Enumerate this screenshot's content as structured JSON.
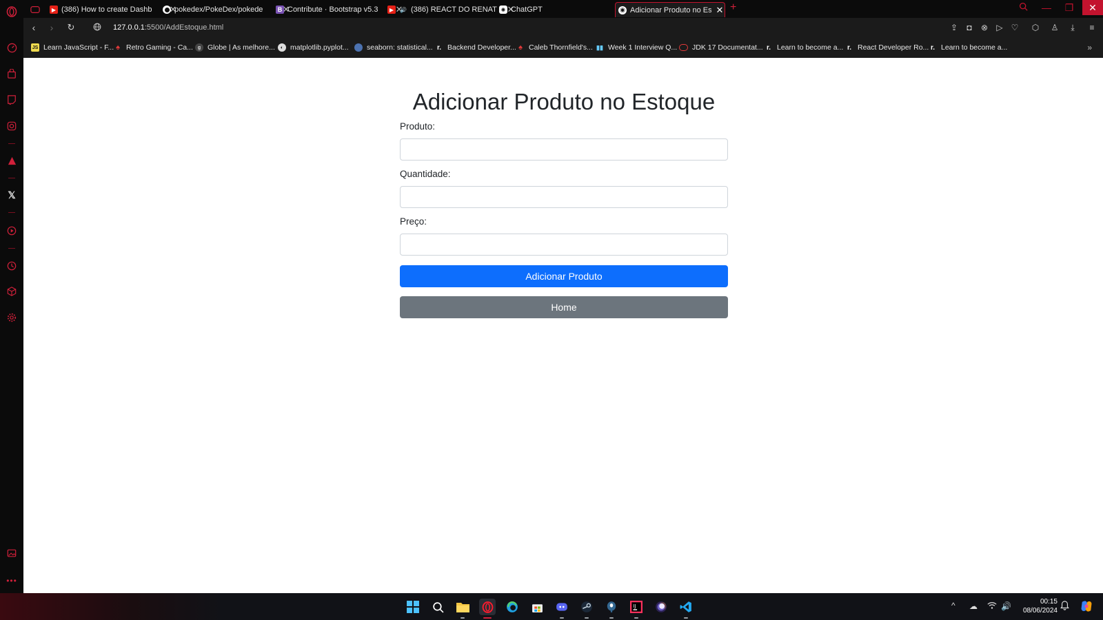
{
  "browser": {
    "tabs": [
      {
        "title": "(386) How to create Dashb",
        "icon": "youtube-icon"
      },
      {
        "title": "pokedex/PokeDex/pokede",
        "icon": "github-icon"
      },
      {
        "title": "Contribute · Bootstrap v5.3",
        "icon": "bootstrap-icon"
      },
      {
        "title": "(386) REACT DO RENAT",
        "icon": "youtube-icon"
      },
      {
        "title": "ChatGPT",
        "icon": "chatgpt-icon"
      },
      {
        "title": "Adicionar Produto no Estoq",
        "icon": "globe-icon",
        "active": true
      }
    ],
    "url_host": "127.0.0.1",
    "url_path": ":5500/AddEstoque.html",
    "bookmarks": [
      {
        "label": "Learn JavaScript - F..."
      },
      {
        "label": "Retro Gaming - Ca..."
      },
      {
        "label": "Globe | As melhore..."
      },
      {
        "label": "matplotlib.pyplot..."
      },
      {
        "label": "seaborn: statistical..."
      },
      {
        "label": "Backend Developer..."
      },
      {
        "label": "Caleb Thornfield's..."
      },
      {
        "label": "Week 1 Interview Q..."
      },
      {
        "label": "JDK 17 Documentat..."
      },
      {
        "label": "Learn to become a..."
      },
      {
        "label": "React Developer Ro..."
      },
      {
        "label": "Learn to become a..."
      }
    ],
    "accent_color": "#c3132e"
  },
  "page": {
    "title": "Adicionar Produto no Estoque",
    "fields": {
      "produto_label": "Produto:",
      "quantidade_label": "Quantidade:",
      "preco_label": "Preço:"
    },
    "buttons": {
      "add_label": "Adicionar Produto",
      "home_label": "Home"
    },
    "colors": {
      "primary": "#0d6efd",
      "secondary": "#6c757d"
    }
  },
  "taskbar": {
    "time": "00:15",
    "date": "08/06/2024"
  }
}
